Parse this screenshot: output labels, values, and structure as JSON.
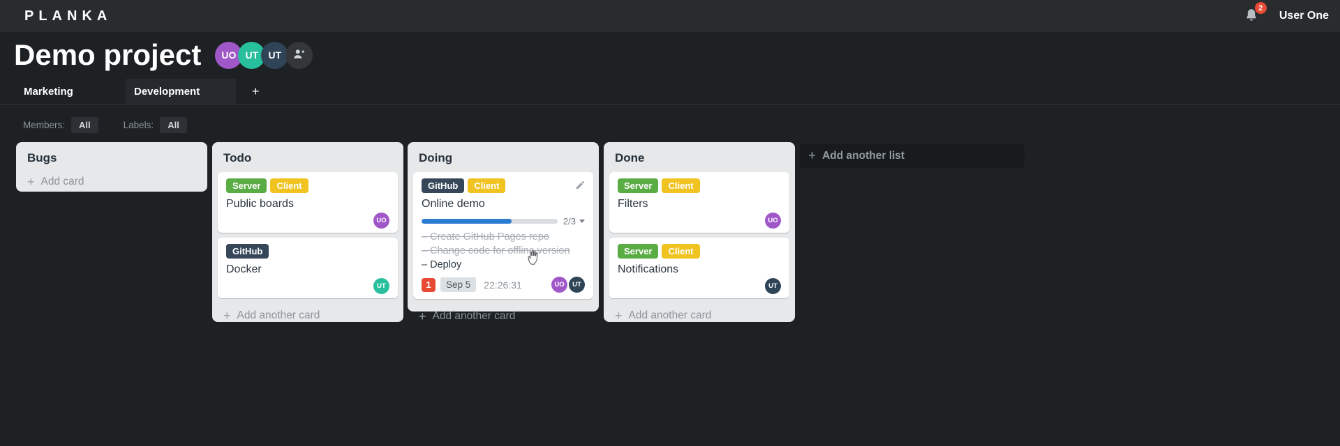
{
  "topbar": {
    "logo": "PLANKA",
    "notification_count": "2",
    "user_name": "User One"
  },
  "project": {
    "title": "Demo project"
  },
  "project_members": [
    {
      "initials": "UO",
      "color": "#a058c8"
    },
    {
      "initials": "UT",
      "color": "#28bf9d"
    },
    {
      "initials": "UT",
      "color": "#2f4457"
    }
  ],
  "icons": {
    "plus": "+"
  },
  "tabs": {
    "marketing": "Marketing",
    "development": "Development"
  },
  "filters": {
    "members_label": "Members:",
    "members_value": "All",
    "labels_label": "Labels:",
    "labels_value": "All"
  },
  "labels": {
    "server": {
      "text": "Server",
      "color": "#5aad45"
    },
    "client": {
      "text": "Client",
      "color": "#f0c321"
    },
    "github": {
      "text": "GitHub",
      "color": "#36475a"
    }
  },
  "lists": {
    "bugs": {
      "title": "Bugs",
      "add_card_label": "Add card"
    },
    "todo": {
      "title": "Todo",
      "add_card_label": "Add another card",
      "card_public_boards": {
        "title": "Public boards",
        "avatar": {
          "initials": "UO",
          "color": "#a058c8"
        }
      },
      "card_docker": {
        "title": "Docker",
        "avatar": {
          "initials": "UT",
          "color": "#28bf9d"
        }
      }
    },
    "doing": {
      "title": "Doing",
      "add_card_label": "Add another card",
      "card_online_demo": {
        "title": "Online demo",
        "progress": {
          "label": "2/3",
          "percent": "66%",
          "color": "#2b7dd1"
        },
        "tasks": {
          "t1": {
            "text": "Create GitHub Pages repo"
          },
          "t2": {
            "text": "Change code for offline version"
          },
          "t3": {
            "text": "Deploy"
          }
        },
        "notification_count": "1",
        "due_date": "Sep 5",
        "timer": "22:26:31",
        "avatars": [
          {
            "initials": "UO",
            "color": "#a058c8"
          },
          {
            "initials": "UT",
            "color": "#2f4457"
          }
        ]
      }
    },
    "done": {
      "title": "Done",
      "add_card_label": "Add another card",
      "card_filters": {
        "title": "Filters",
        "avatar": {
          "initials": "UO",
          "color": "#a058c8"
        }
      },
      "card_notifications": {
        "title": "Notifications",
        "avatar": {
          "initials": "UT",
          "color": "#2f4457"
        }
      }
    }
  },
  "add_list_label": "Add another list",
  "ui": {
    "badge_red": "#e74a33"
  }
}
